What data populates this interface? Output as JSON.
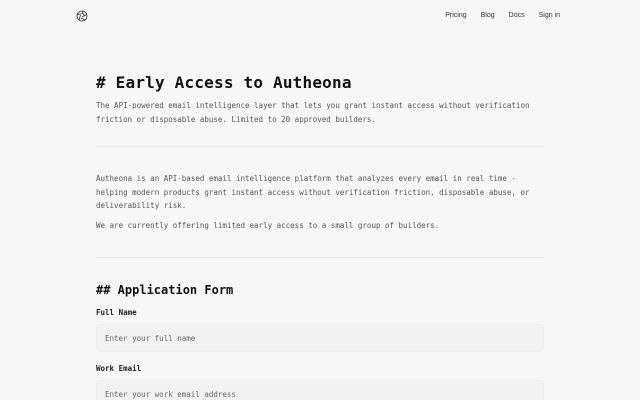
{
  "nav": {
    "logo_icon": "aperture-logo-icon",
    "items": [
      {
        "label": "Pricing"
      },
      {
        "label": "Blog"
      },
      {
        "label": "Docs"
      },
      {
        "label": "Sign in"
      }
    ]
  },
  "hero": {
    "title": "# Early Access to Autheona",
    "subtitle": "The API-powered email intelligence layer that lets you grant instant access without verification friction or disposable abuse. Limited to 20 approved builders."
  },
  "about": {
    "paragraph1": "Autheona is an API-based email intelligence platform that analyzes every email in real time - helping modern products grant instant access without verification friction, disposable abuse, or deliverability risk.",
    "paragraph2": "We are currently offering limited early access to a small group of builders."
  },
  "form": {
    "heading": "## Application Form",
    "full_name": {
      "label": "Full Name",
      "placeholder": "Enter your full name"
    },
    "work_email": {
      "label": "Work Email",
      "placeholder": "Enter your work email address"
    }
  }
}
